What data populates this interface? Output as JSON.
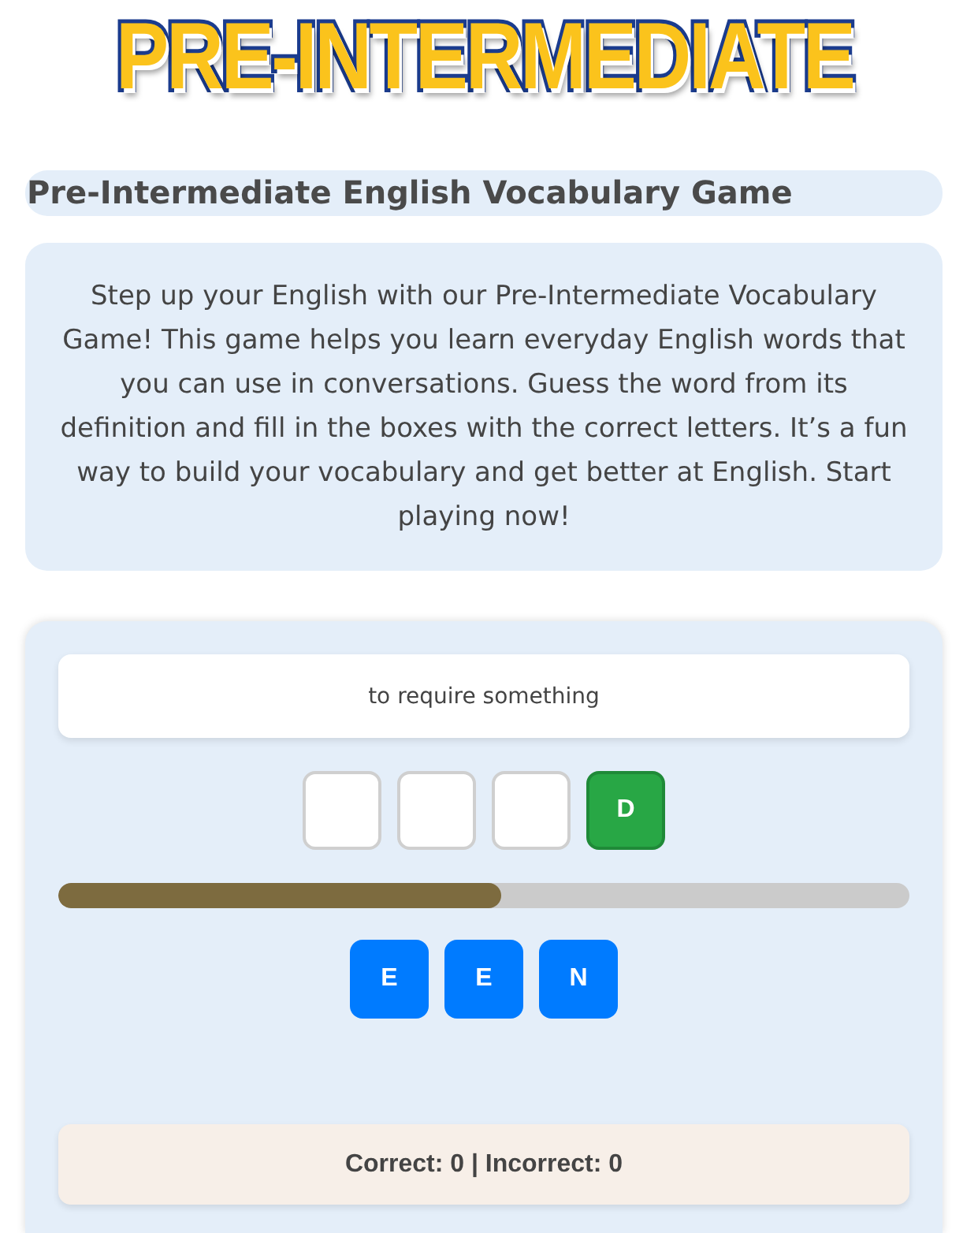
{
  "logo": {
    "text": "PRE-INTERMEDIATE"
  },
  "title": "Pre-Intermediate English Vocabulary Game",
  "description": "Step up your English with our Pre-Intermediate Vocabulary Game! This game helps you learn everyday English words that you can use in conversations. Guess the word from its definition and fill in the boxes with the correct letters. It’s a fun way to build your vocabulary and get better at English. Start playing now!",
  "game": {
    "definition": "to require something",
    "slots": [
      {
        "filled": false
      },
      {
        "filled": false
      },
      {
        "filled": false
      },
      {
        "filled": true,
        "letter": "D"
      }
    ],
    "progress": {
      "level": 0.52
    },
    "letter_choices": [
      "E",
      "E",
      "N"
    ],
    "score": "Correct: 0 | Incorrect: 0"
  }
}
